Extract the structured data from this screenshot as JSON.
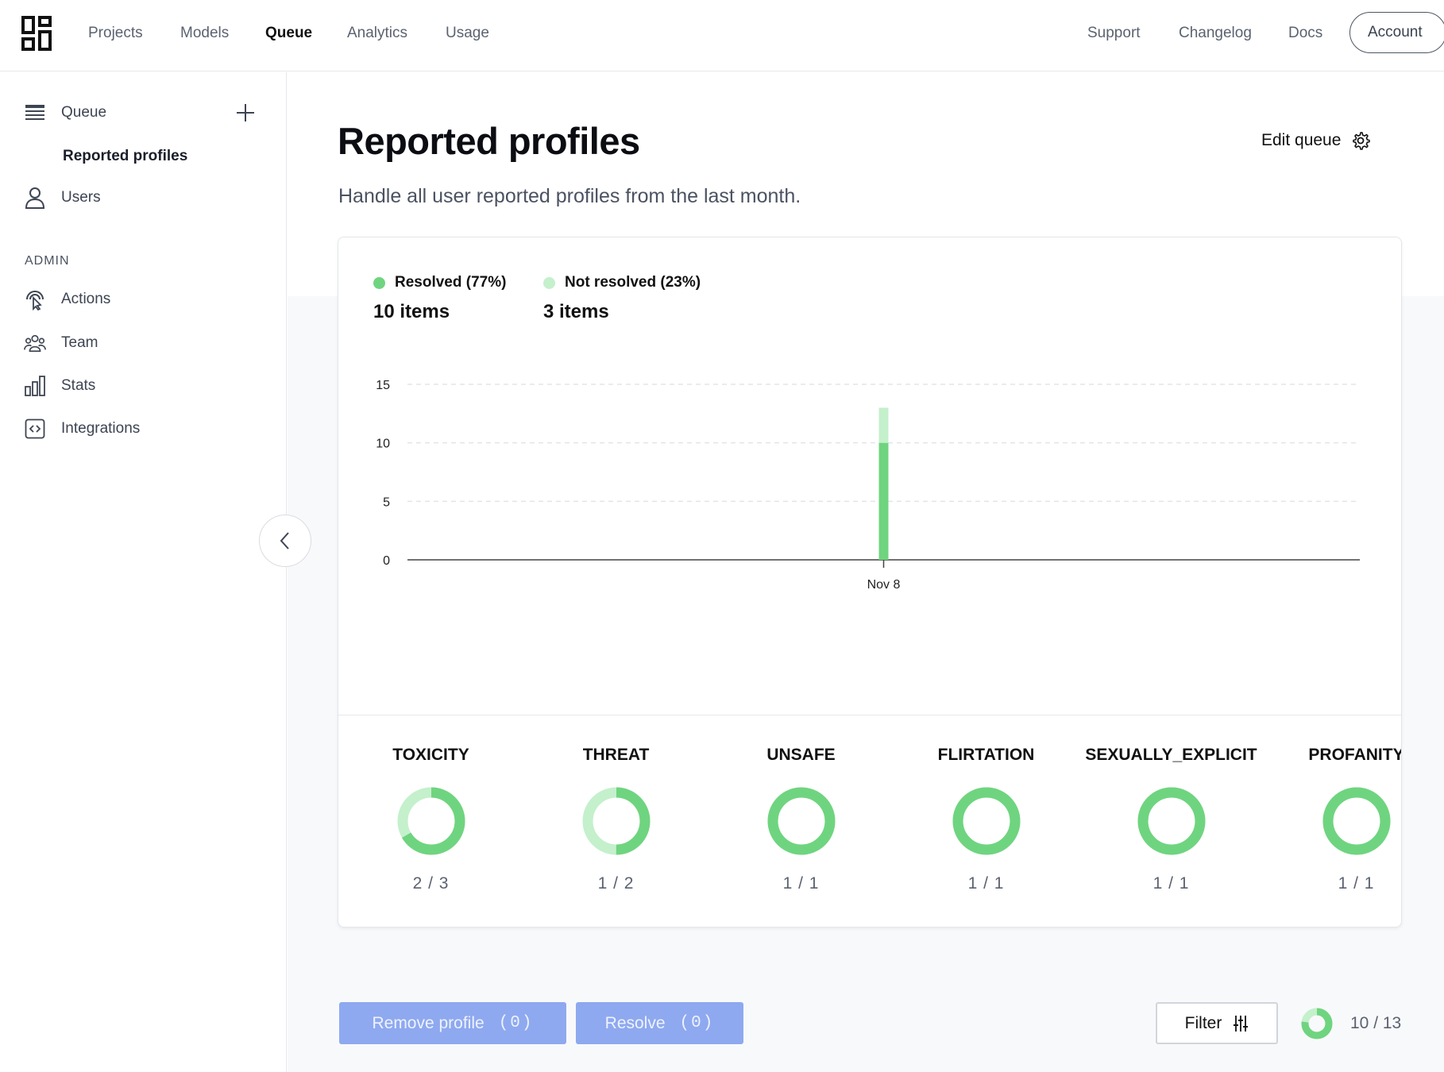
{
  "nav": {
    "left": [
      "Projects",
      "Models",
      "Queue",
      "Analytics",
      "Usage"
    ],
    "active": "Queue",
    "right": [
      "Support",
      "Changelog",
      "Docs"
    ],
    "account": "Account"
  },
  "sidebar": {
    "queue_label": "Queue",
    "sub_label": "Reported profiles",
    "users_label": "Users",
    "admin_heading": "ADMIN",
    "admin_items": [
      {
        "label": "Actions",
        "icon": "pointer-icon"
      },
      {
        "label": "Team",
        "icon": "team-icon"
      },
      {
        "label": "Stats",
        "icon": "bar-chart-icon"
      },
      {
        "label": "Integrations",
        "icon": "code-icon"
      }
    ]
  },
  "page": {
    "title": "Reported profiles",
    "subtitle": "Handle all user reported profiles from the last month.",
    "edit_queue": "Edit queue"
  },
  "legend": [
    {
      "label": "Resolved (77%)",
      "count": "10 items",
      "color": "#6fd47f"
    },
    {
      "label": "Not resolved (23%)",
      "count": "3 items",
      "color": "#c4f0cc"
    }
  ],
  "chart_data": {
    "type": "bar",
    "stacked": true,
    "categories": [
      "Nov 8"
    ],
    "series": [
      {
        "name": "Resolved",
        "values": [
          10
        ],
        "color": "#6fd47f"
      },
      {
        "name": "Not resolved",
        "values": [
          3
        ],
        "color": "#c4f0cc"
      }
    ],
    "yticks": [
      "0",
      "5",
      "10",
      "15"
    ],
    "ylim": [
      0,
      15
    ],
    "grid": "dashed horizontal"
  },
  "metrics": [
    {
      "name": "TOXICITY",
      "count": "2 / 3",
      "resolved": 2,
      "total": 3
    },
    {
      "name": "THREAT",
      "count": "1 / 2",
      "resolved": 1,
      "total": 2
    },
    {
      "name": "UNSAFE",
      "count": "1 / 1",
      "resolved": 1,
      "total": 1
    },
    {
      "name": "FLIRTATION",
      "count": "1 / 1",
      "resolved": 1,
      "total": 1
    },
    {
      "name": "SEXUALLY_EXPLICIT",
      "count": "1 / 1",
      "resolved": 1,
      "total": 1
    },
    {
      "name": "PROFANITY",
      "count": "1 / 1",
      "resolved": 1,
      "total": 1
    }
  ],
  "actions": {
    "remove_label": "Remove profile",
    "remove_count": "(0)",
    "resolve_label": "Resolve",
    "resolve_count": "(0)",
    "filter_label": "Filter",
    "progress_text": "10 / 13",
    "progress_resolved": 10,
    "progress_total": 13
  },
  "colors": {
    "resolved": "#6fd47f",
    "unresolved": "#c4f0cc",
    "button": "#8ea9ef"
  }
}
